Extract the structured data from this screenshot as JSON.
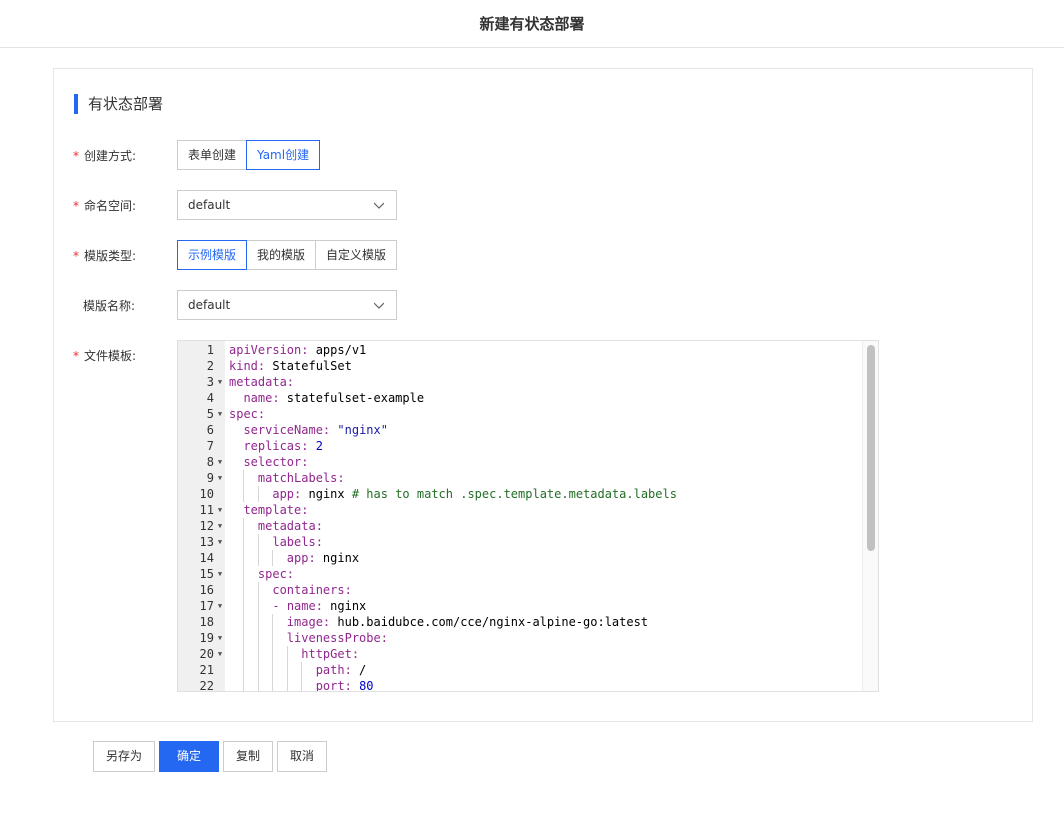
{
  "header": {
    "title": "新建有状态部署"
  },
  "panel": {
    "title": "有状态部署"
  },
  "form": {
    "create_method": {
      "label": "创建方式:",
      "required": true,
      "options": [
        "表单创建",
        "Yaml创建"
      ],
      "selected": "Yaml创建"
    },
    "namespace": {
      "label": "命名空间:",
      "required": true,
      "value": "default"
    },
    "template_type": {
      "label": "模版类型:",
      "required": true,
      "options": [
        "示例模版",
        "我的模版",
        "自定义模版"
      ],
      "selected": "示例模版"
    },
    "template_name": {
      "label": "模版名称:",
      "required": false,
      "value": "default"
    },
    "file_template": {
      "label": "文件模板:",
      "required": true,
      "lines": [
        "apiVersion: apps/v1",
        "kind: StatefulSet",
        "metadata:",
        "  name: statefulset-example",
        "spec:",
        "  serviceName: \"nginx\"",
        "  replicas: 2",
        "  selector:",
        "    matchLabels:",
        "      app: nginx # has to match .spec.template.metadata.labels",
        "  template:",
        "    metadata:",
        "      labels:",
        "        app: nginx",
        "    spec:",
        "      containers:",
        "      - name: nginx",
        "        image: hub.baidubce.com/cce/nginx-alpine-go:latest",
        "        livenessProbe:",
        "          httpGet:",
        "            path: /",
        "            port: 80"
      ],
      "foldable_lines": [
        3,
        5,
        8,
        9,
        11,
        12,
        13,
        15,
        17,
        19,
        20
      ]
    }
  },
  "footer": {
    "save_as": "另存为",
    "confirm": "确定",
    "copy": "复制",
    "cancel": "取消"
  },
  "colors": {
    "primary": "#2468f2",
    "required": "#ea2e2e",
    "yaml_key": "#92278f",
    "yaml_comment": "#236e25",
    "yaml_number": "#0000cd"
  },
  "icons": {
    "select_arrow": "chevron-down-icon",
    "fold_marker": "fold-arrow-icon"
  }
}
